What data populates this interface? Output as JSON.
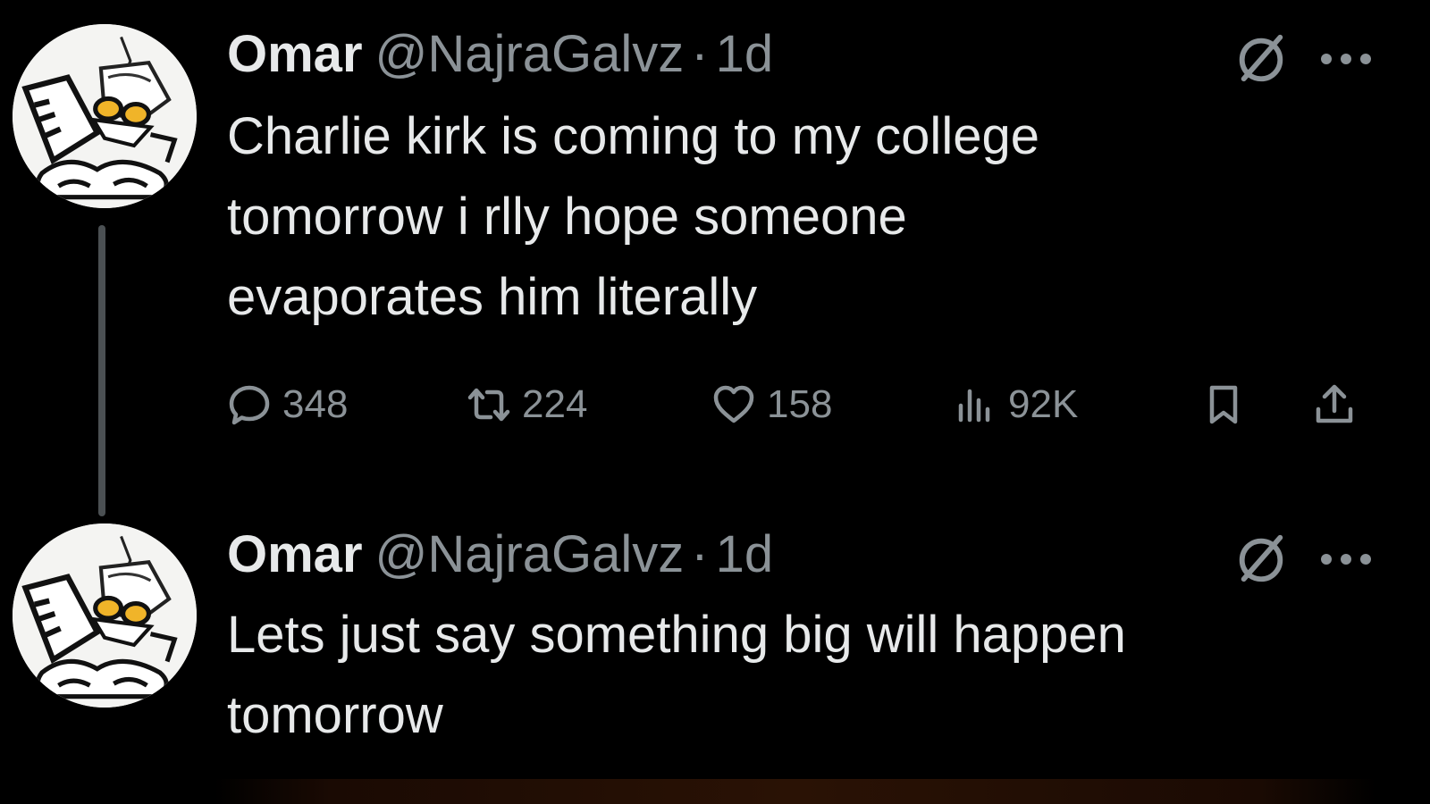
{
  "tweets": [
    {
      "author": {
        "name": "Omar",
        "handle": "@NajraGalvz",
        "separator": "·",
        "time": "1d"
      },
      "text_lines": [
        "Charlie kirk is coming to my college",
        "tomorrow i rlly hope someone",
        "evaporates him literally"
      ],
      "actions": {
        "replies": "348",
        "retweets": "224",
        "likes": "158",
        "views": "92K"
      }
    },
    {
      "author": {
        "name": "Omar",
        "handle": "@NajraGalvz",
        "separator": "·",
        "time": "1d"
      },
      "text_lines": [
        "Lets just say something big will happen",
        "tomorrow"
      ]
    }
  ],
  "icons": {
    "grok": "grok-icon",
    "more": "more-icon",
    "reply": "reply-icon",
    "retweet": "retweet-icon",
    "like": "heart-icon",
    "views": "analytics-icon",
    "bookmark": "bookmark-icon",
    "share": "share-icon"
  },
  "colors": {
    "background": "#000000",
    "text": "#e7e9ea",
    "secondary_text": "#8b9297",
    "thread_line": "#4b5053"
  }
}
